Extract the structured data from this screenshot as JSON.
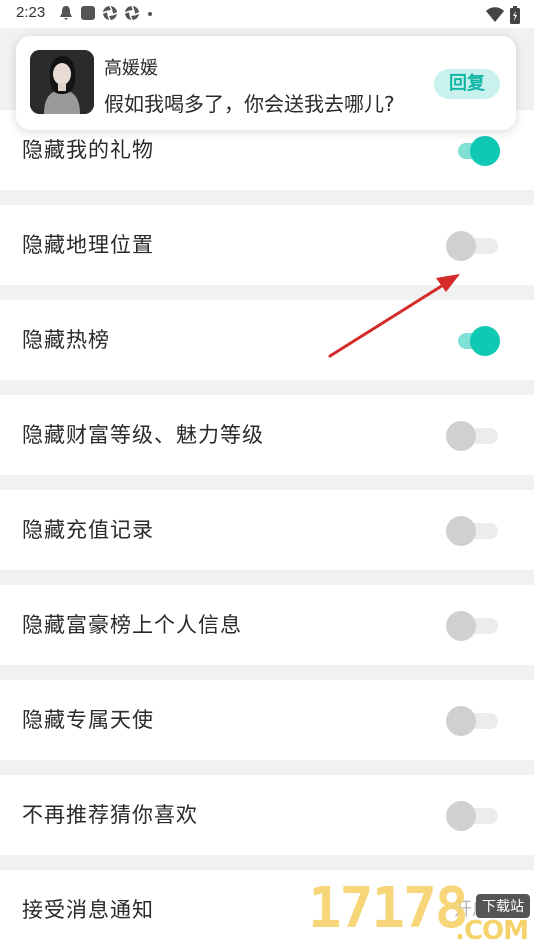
{
  "status_bar": {
    "time": "2:23",
    "icons": [
      "notification-bell-icon",
      "app-square-icon",
      "aperture-icon",
      "aperture-icon",
      "dot-icon"
    ],
    "right_icons": [
      "wifi-icon",
      "battery-icon"
    ]
  },
  "notification": {
    "sender": "高媛媛",
    "message": "假如我喝多了，你会送我去哪儿?",
    "reply_label": "回复"
  },
  "settings": [
    {
      "label": "隐藏我的礼物",
      "on": true
    },
    {
      "label": "隐藏地理位置",
      "on": false
    },
    {
      "label": "隐藏热榜",
      "on": true
    },
    {
      "label": "隐藏财富等级、魅力等级",
      "on": false
    },
    {
      "label": "隐藏充值记录",
      "on": false
    },
    {
      "label": "隐藏富豪榜上个人信息",
      "on": false
    },
    {
      "label": "隐藏专属天使",
      "on": false
    },
    {
      "label": "不再推荐猜你喜欢",
      "on": false
    },
    {
      "label": "接受消息通知",
      "extra": "开启"
    }
  ],
  "watermark": {
    "number": "17178",
    "badge": "下载站",
    "suffix": ".COM"
  },
  "colors": {
    "accent": "#0fc9b5",
    "toggle_on_track": "#7fe0d4",
    "toggle_off": "#d0d0d0",
    "arrow": "#d42a2a"
  }
}
